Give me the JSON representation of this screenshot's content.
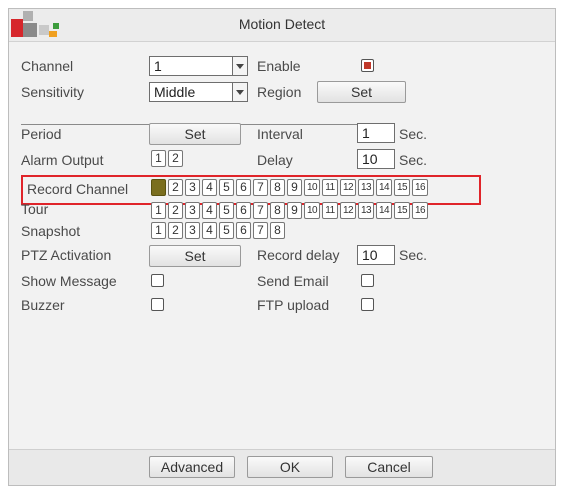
{
  "window": {
    "title": "Motion Detect"
  },
  "colors": {
    "highlight": "#e0242a",
    "selected_channel": "#7a6e1e",
    "checkbox_mark": "#c0392b"
  },
  "fields": {
    "channel": {
      "label": "Channel",
      "value": "1"
    },
    "enable": {
      "label": "Enable",
      "checked": true
    },
    "sensitivity": {
      "label": "Sensitivity",
      "value": "Middle"
    },
    "region": {
      "label": "Region",
      "button": "Set"
    },
    "period": {
      "label": "Period",
      "button": "Set"
    },
    "interval": {
      "label": "Interval",
      "value": "1",
      "unit": "Sec."
    },
    "alarm_output": {
      "label": "Alarm Output",
      "channels": [
        "1",
        "2"
      ]
    },
    "delay": {
      "label": "Delay",
      "value": "10",
      "unit": "Sec."
    },
    "record_channel": {
      "label": "Record Channel",
      "channels": [
        "1",
        "2",
        "3",
        "4",
        "5",
        "6",
        "7",
        "8",
        "9",
        "10",
        "11",
        "12",
        "13",
        "14",
        "15",
        "16"
      ],
      "selected": [
        "1"
      ]
    },
    "tour": {
      "label": "Tour",
      "channels": [
        "1",
        "2",
        "3",
        "4",
        "5",
        "6",
        "7",
        "8",
        "9",
        "10",
        "11",
        "12",
        "13",
        "14",
        "15",
        "16"
      ]
    },
    "snapshot": {
      "label": "Snapshot",
      "channels": [
        "1",
        "2",
        "3",
        "4",
        "5",
        "6",
        "7",
        "8"
      ]
    },
    "ptz_activation": {
      "label": "PTZ Activation",
      "button": "Set"
    },
    "record_delay": {
      "label": "Record delay",
      "value": "10",
      "unit": "Sec."
    },
    "show_message": {
      "label": "Show Message",
      "checked": false
    },
    "send_email": {
      "label": "Send Email",
      "checked": false
    },
    "buzzer": {
      "label": "Buzzer",
      "checked": false
    },
    "ftp_upload": {
      "label": "FTP upload",
      "checked": false
    }
  },
  "buttons": {
    "advanced": "Advanced",
    "ok": "OK",
    "cancel": "Cancel"
  }
}
